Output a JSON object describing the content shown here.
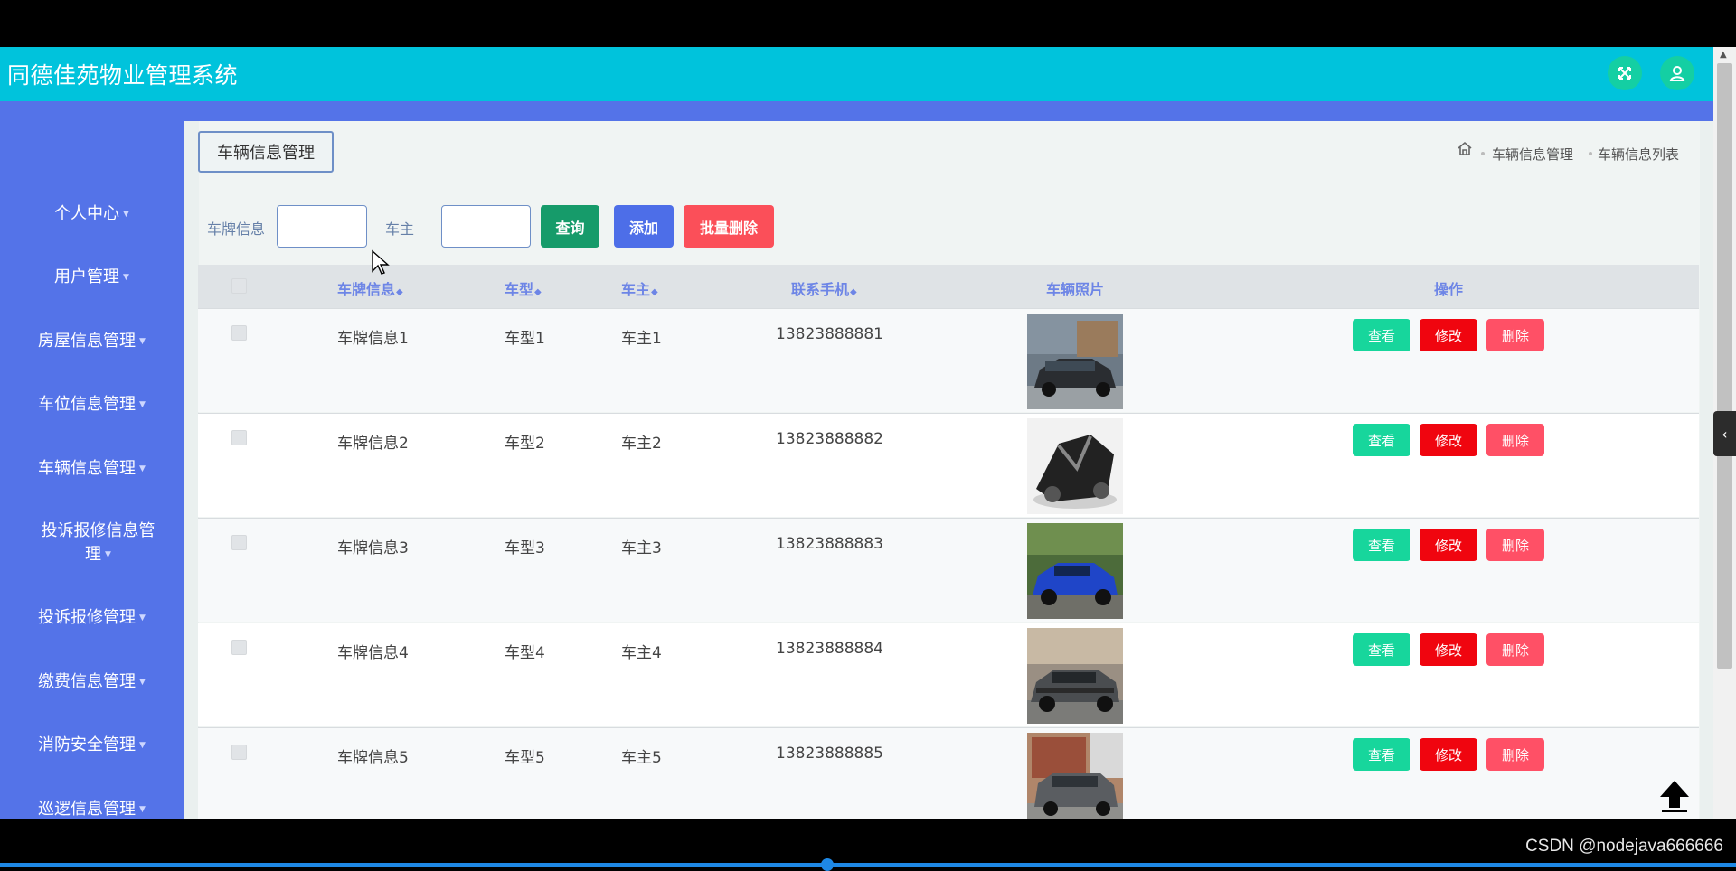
{
  "header": {
    "title": "同德佳苑物业管理系统"
  },
  "sidebar": {
    "items": [
      {
        "label": "个人中心"
      },
      {
        "label": "用户管理"
      },
      {
        "label": "房屋信息管理"
      },
      {
        "label": "车位信息管理"
      },
      {
        "label": "车辆信息管理"
      },
      {
        "label": "投诉报修信息管",
        "label2": "理"
      },
      {
        "label": "投诉报修管理"
      },
      {
        "label": "缴费信息管理"
      },
      {
        "label": "消防安全管理"
      },
      {
        "label": "巡逻信息管理"
      }
    ]
  },
  "page": {
    "tag": "车辆信息管理",
    "breadcrumb": [
      "车辆信息管理",
      "车辆信息列表"
    ]
  },
  "filters": {
    "plate_label": "车牌信息",
    "plate_value": "",
    "owner_label": "车主",
    "owner_value": "",
    "search_btn": "查询",
    "add_btn": "添加",
    "batch_delete_btn": "批量删除"
  },
  "table": {
    "headers": [
      "车牌信息",
      "车型",
      "车主",
      "联系手机",
      "车辆照片",
      "操作"
    ],
    "rows": [
      {
        "plate": "车牌信息1",
        "model": "车型1",
        "owner": "车主1",
        "phone": "13823888881"
      },
      {
        "plate": "车牌信息2",
        "model": "车型2",
        "owner": "车主2",
        "phone": "13823888882"
      },
      {
        "plate": "车牌信息3",
        "model": "车型3",
        "owner": "车主3",
        "phone": "13823888883"
      },
      {
        "plate": "车牌信息4",
        "model": "车型4",
        "owner": "车主4",
        "phone": "13823888884"
      },
      {
        "plate": "车牌信息5",
        "model": "车型5",
        "owner": "车主5",
        "phone": "13823888885"
      }
    ],
    "actions": {
      "view": "查看",
      "edit": "修改",
      "delete": "删除"
    }
  },
  "watermark": "CSDN @nodejava666666",
  "colors": {
    "header": "#00c3dc",
    "sidebar": "#5473e8",
    "search": "#169b6a",
    "add": "#4d6ee8",
    "batch_delete": "#fb4f59",
    "view": "#17d69c",
    "edit": "#f0050f",
    "delete": "#ff5066"
  },
  "icons": [
    "fullscreen-icon",
    "user-icon",
    "home-icon",
    "back-to-top-icon",
    "chevron-left-icon"
  ]
}
